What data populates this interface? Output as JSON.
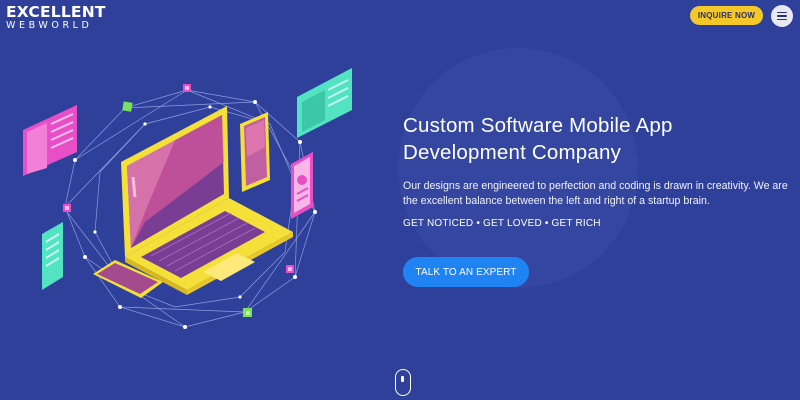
{
  "brand": {
    "logo_line1": "EXCELLENT",
    "logo_line2": "WEBWORLD"
  },
  "header": {
    "inquire_label": "INQUIRE NOW",
    "menu_icon": "hamburger-menu-icon"
  },
  "hero": {
    "title_line1": "Custom Software Mobile App",
    "title_line2": "Development Company",
    "description": "Our designs are engineered to perfection and coding is drawn in creativity. We are the excellent balance between the left and right of a startup brain.",
    "tagline": "GET NOTICED • GET LOVED • GET RICH",
    "cta_label": "TALK TO AN EXPERT"
  },
  "scroll": {
    "icon": "mouse-scroll-icon"
  },
  "colors": {
    "background": "#2f409b",
    "accent_yellow": "#f5c82a",
    "cta_blue": "#1f84f2",
    "illustration_pink": "#e84ec6",
    "illustration_teal": "#52e3c3"
  }
}
